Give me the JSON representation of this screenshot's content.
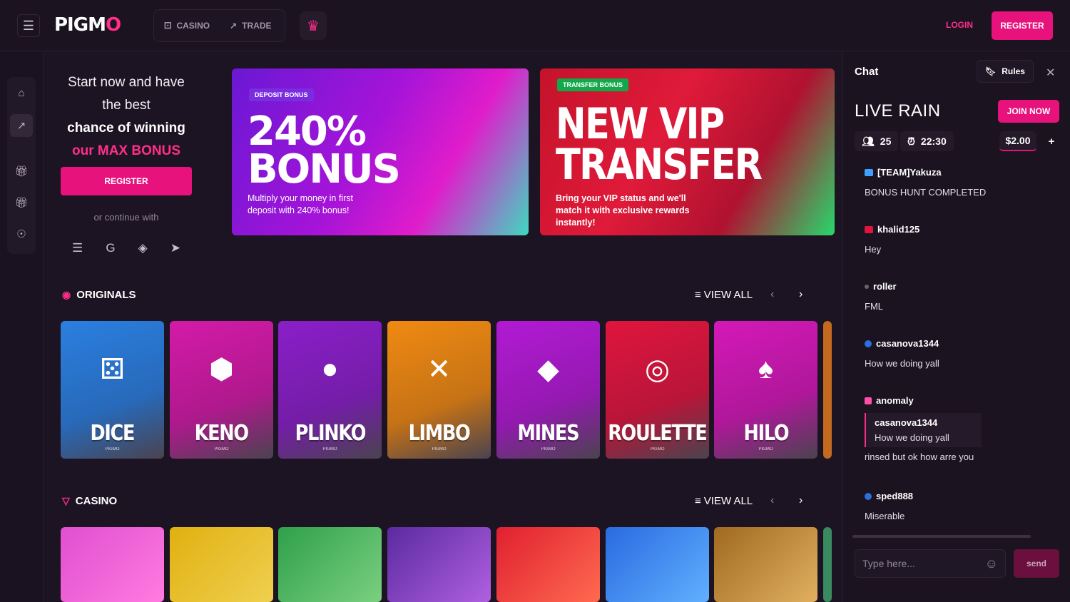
{
  "header": {
    "logo": "PIGM",
    "logo_o": "O",
    "nav": [
      {
        "label": "CASINO",
        "icon": "dice-icon"
      },
      {
        "label": "TRADE",
        "icon": "chart-icon"
      }
    ],
    "login": "LOGIN",
    "register": "REGISTER"
  },
  "promo": {
    "line1": "Start now and have",
    "line2": "the best",
    "line3": "chance of winning",
    "line4": "our MAX BONUS",
    "register": "REGISTER",
    "continue": "or continue with"
  },
  "banners": [
    {
      "tag": "DEPOSIT BONUS",
      "title1": "240%",
      "title2": "BONUS",
      "sub": "Multiply your money in first deposit with 240% bonus!"
    },
    {
      "tag": "TRANSFER BONUS",
      "title1": "NEW VIP",
      "title2": "TRANSFER",
      "sub": "Bring your VIP status and we'll match it with exclusive rewards instantly!"
    }
  ],
  "originals": {
    "title": "ORIGINALS",
    "view_all": "VIEW ALL",
    "games": [
      {
        "name": "DICE",
        "studio": "PIGMO",
        "color": "#2a7fe0"
      },
      {
        "name": "KENO",
        "studio": "PIGMO",
        "color": "#d41aa8"
      },
      {
        "name": "PLINKO",
        "studio": "PIGMO",
        "color": "#8a1fc9"
      },
      {
        "name": "LIMBO",
        "studio": "PIGMO",
        "color": "#f08a12"
      },
      {
        "name": "MINES",
        "studio": "PIGMO",
        "color": "#b21ad4"
      },
      {
        "name": "ROULETTE",
        "studio": "PIGMO",
        "color": "#e0153e"
      },
      {
        "name": "HILO",
        "studio": "PIGMO",
        "color": "#d418b8"
      }
    ]
  },
  "casino": {
    "title": "CASINO",
    "view_all": "VIEW ALL"
  },
  "chat": {
    "title": "Chat",
    "rules": "Rules",
    "rain_title": "LIVE RAIN",
    "join": "JOIN NOW",
    "users": "25",
    "timer": "22:30",
    "amount": "$2.00",
    "plus": "+",
    "messages": [
      {
        "user": "[TEAM]Yakuza",
        "text": "BONUS HUNT COMPLETED",
        "badge": "#3fa0ff"
      },
      {
        "user": "khalid125",
        "text": "Hey",
        "badge": "#e0153e"
      },
      {
        "user": "roller",
        "text": "FML",
        "badge": "#6a6070"
      },
      {
        "user": "casanova1344",
        "text": "How we doing yall",
        "badge": "#2b6fe0"
      },
      {
        "user": "anomaly",
        "text": "rinsed but ok how arre you",
        "badge": "#ff4fa8",
        "reply_user": "casanova1344",
        "reply_text": "How we doing yall"
      },
      {
        "user": "sped888",
        "text": "Miserable",
        "badge": "#2b6fe0"
      }
    ],
    "placeholder": "Type here...",
    "send": "send"
  }
}
